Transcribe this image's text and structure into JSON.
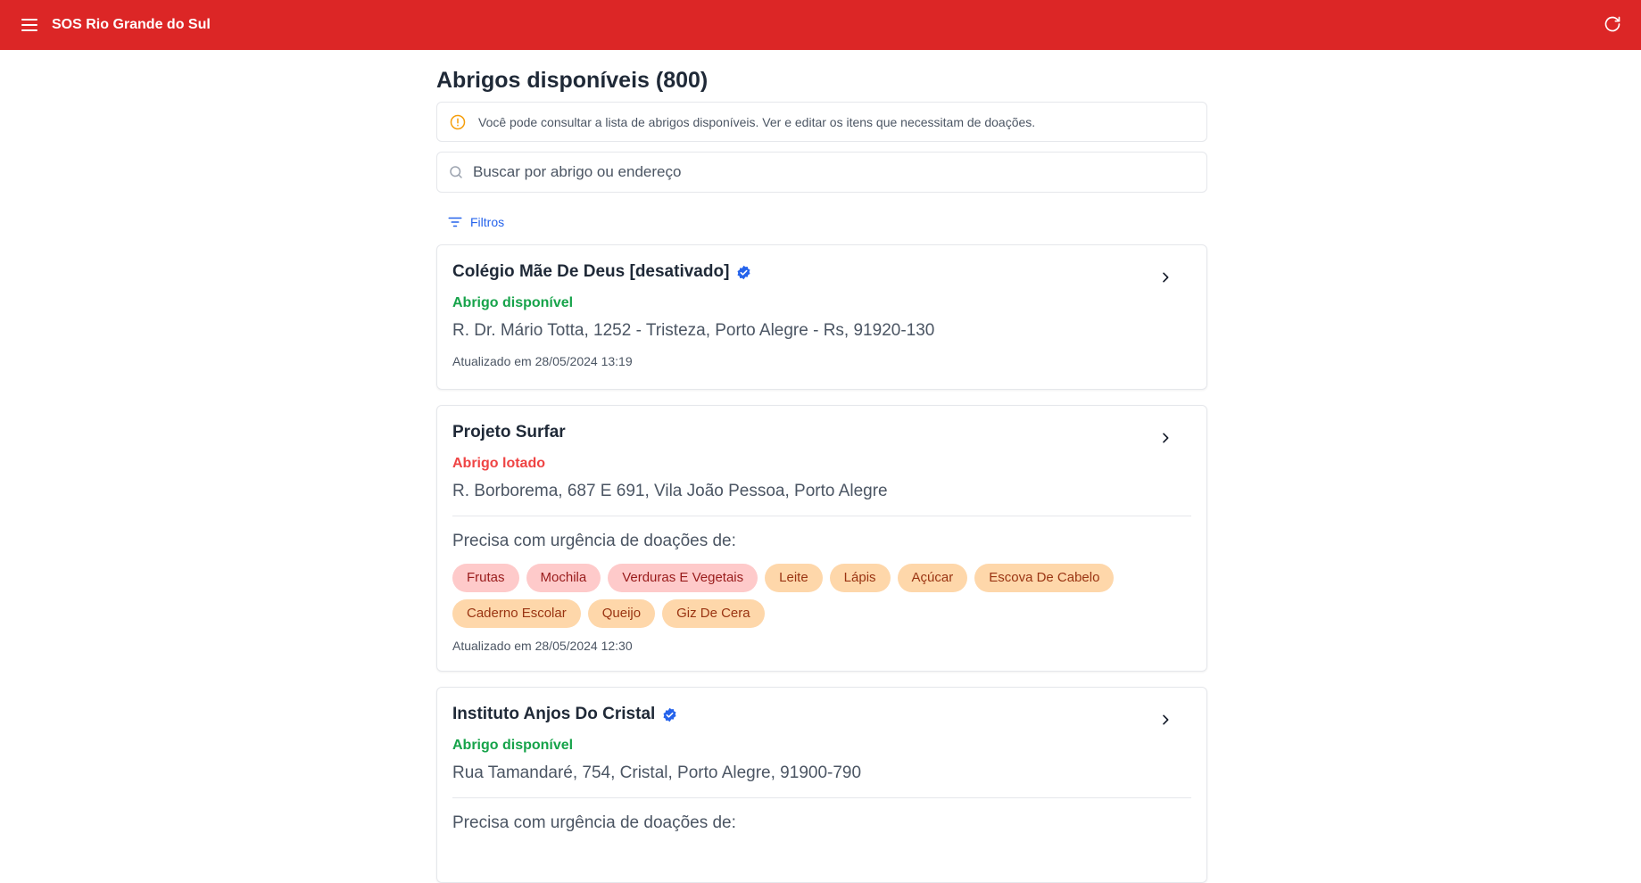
{
  "header": {
    "title": "SOS Rio Grande do Sul",
    "menu_icon": "menu-icon",
    "refresh_icon": "refresh-icon",
    "color": "#dc2626"
  },
  "page": {
    "title": "Abrigos disponíveis (800)",
    "info": "Você pode consultar a lista de abrigos disponíveis. Ver e editar os itens que necessitam de doações.",
    "search_placeholder": "Buscar por abrigo ou endereço",
    "filters_label": "Filtros"
  },
  "shelters": [
    {
      "name": "Colégio Mãe De Deus [desativado]",
      "verified": true,
      "status": "Abrigo disponível",
      "address": "R. Dr. Mário Totta, 1252 - Tristeza, Porto Alegre - Rs, 91920-130",
      "updated": "Atualizado em 28/05/2024 13:19"
    },
    {
      "name": "Projeto Surfar",
      "verified": false,
      "status": "Abrigo lotado",
      "address": "R. Borborema, 687 E 691, Vila João Pessoa, Porto Alegre",
      "needs_title": "Precisa com urgência de doações de:",
      "needs": [
        {
          "label": "Frutas",
          "level": "red"
        },
        {
          "label": "Mochila",
          "level": "red"
        },
        {
          "label": "Verduras E Vegetais",
          "level": "red"
        },
        {
          "label": "Leite",
          "level": "orange"
        },
        {
          "label": "Lápis",
          "level": "orange"
        },
        {
          "label": "Açúcar",
          "level": "orange"
        },
        {
          "label": "Escova De Cabelo",
          "level": "orange"
        },
        {
          "label": "Caderno Escolar",
          "level": "orange"
        },
        {
          "label": "Queijo",
          "level": "orange"
        },
        {
          "label": "Giz De Cera",
          "level": "orange"
        }
      ],
      "updated": "Atualizado em 28/05/2024 12:30"
    },
    {
      "name": "Instituto Anjos Do Cristal",
      "verified": true,
      "status": "Abrigo disponível",
      "address": "Rua Tamandaré, 754, Cristal, Porto Alegre, 91900-790",
      "needs_title": "Precisa com urgência de doações de:"
    }
  ],
  "colors": {
    "available": "#16a34a",
    "full": "#ef4444",
    "tag_red": "#fecaca",
    "tag_orange": "#fed7aa",
    "link": "#2563eb"
  }
}
